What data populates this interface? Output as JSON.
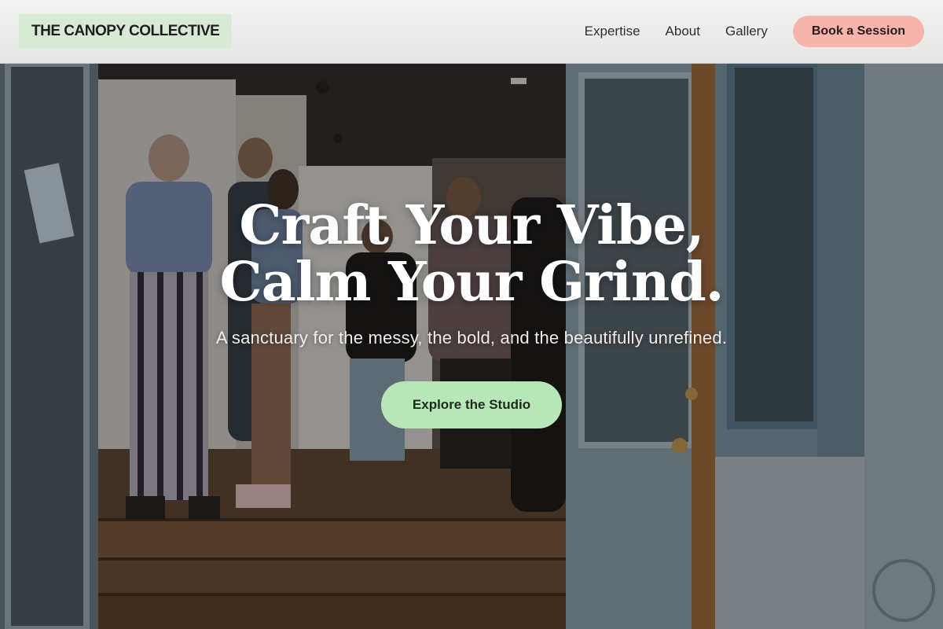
{
  "header": {
    "logo": "THE CANOPY COLLECTIVE",
    "nav": [
      "Expertise",
      "About",
      "Gallery"
    ],
    "cta": "Book a Session"
  },
  "hero": {
    "title": "Craft Your Vibe, Calm Your Grind.",
    "subtitle": "A sanctuary for the messy, the bold, and the beautifully unrefined.",
    "button": "Explore the Studio"
  },
  "colors": {
    "logo_bg": "#d8e9d6",
    "cta_bg": "#f6b4ad",
    "hero_button_bg": "#b7e6b8",
    "header_bg": "#ececeb"
  }
}
